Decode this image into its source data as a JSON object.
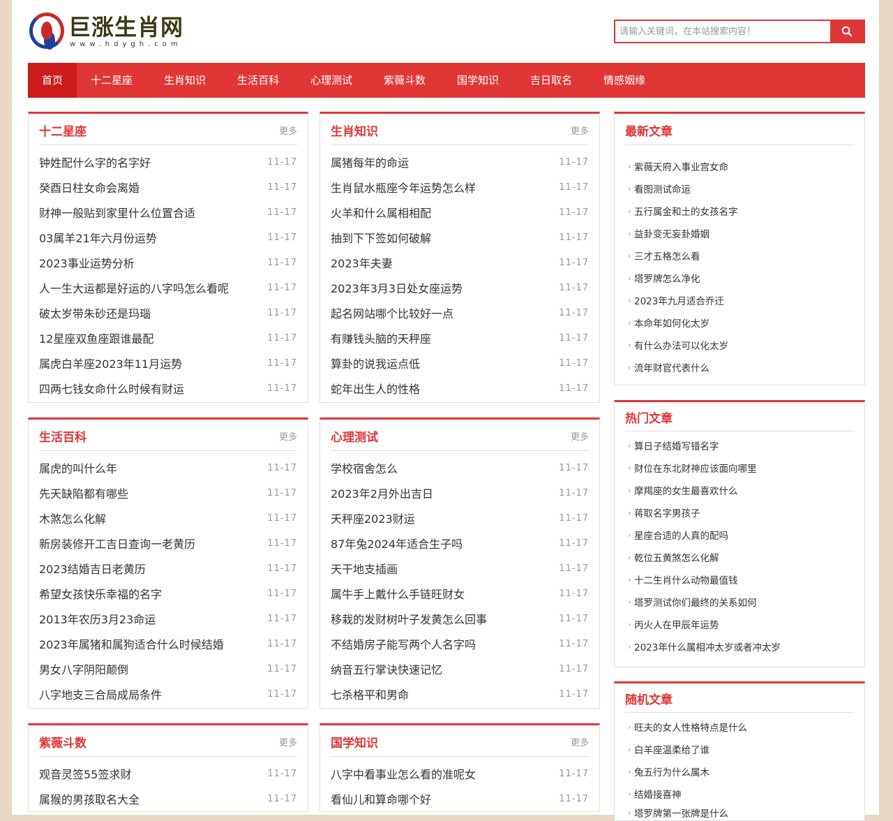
{
  "site": {
    "title": "巨涨生肖网",
    "url": "www.hdygh.com"
  },
  "search": {
    "placeholder": "请输入关键词，在本站搜索内容！"
  },
  "nav": [
    "首页",
    "十二星座",
    "生肖知识",
    "生活百科",
    "心理测试",
    "紫薇斗数",
    "国学知识",
    "吉日取名",
    "情感姻缘"
  ],
  "more_label": "更多",
  "modules": [
    {
      "title": "十二星座",
      "items": [
        [
          "钟姓配什么字的名字好",
          "11-17"
        ],
        [
          "癸酉日柱女命会离婚",
          "11-17"
        ],
        [
          "财神一般贴到家里什么位置合适",
          "11-17"
        ],
        [
          "03属羊21年六月份运势",
          "11-17"
        ],
        [
          "2023事业运势分析",
          "11-17"
        ],
        [
          "人一生大运都是好运的八字吗怎么看呢",
          "11-17"
        ],
        [
          "破太岁带朱砂还是玛瑙",
          "11-17"
        ],
        [
          "12星座双鱼座跟谁最配",
          "11-17"
        ],
        [
          "属虎白羊座2023年11月运势",
          "11-17"
        ],
        [
          "四两七钱女命什么时候有财运",
          "11-17"
        ]
      ]
    },
    {
      "title": "生肖知识",
      "items": [
        [
          "属猪每年的命运",
          "11-17"
        ],
        [
          "生肖鼠水瓶座今年运势怎么样",
          "11-17"
        ],
        [
          "火羊和什么属相相配",
          "11-17"
        ],
        [
          "抽到下下签如何破解",
          "11-17"
        ],
        [
          "2023年夫妻",
          "11-17"
        ],
        [
          "2023年3月3日处女座运势",
          "11-17"
        ],
        [
          "起名网站哪个比较好一点",
          "11-17"
        ],
        [
          "有赚钱头脑的天秤座",
          "11-17"
        ],
        [
          "算卦的说我运点低",
          "11-17"
        ],
        [
          "蛇年出生人的性格",
          "11-17"
        ]
      ]
    },
    {
      "title": "生活百科",
      "items": [
        [
          "属虎的叫什么年",
          "11-17"
        ],
        [
          "先天缺陷都有哪些",
          "11-17"
        ],
        [
          "木煞怎么化解",
          "11-17"
        ],
        [
          "新房装修开工吉日查询一老黄历",
          "11-17"
        ],
        [
          "2023结婚吉日老黄历",
          "11-17"
        ],
        [
          "希望女孩快乐幸福的名字",
          "11-17"
        ],
        [
          "2013年农历3月23命运",
          "11-17"
        ],
        [
          "2023年属猪和属狗适合什么时候结婚",
          "11-17"
        ],
        [
          "男女八字阴阳颠倒",
          "11-17"
        ],
        [
          "八字地支三合局成局条件",
          "11-17"
        ]
      ]
    },
    {
      "title": "心理测试",
      "items": [
        [
          "学校宿舍怎么",
          "11-17"
        ],
        [
          "2023年2月外出吉日",
          "11-17"
        ],
        [
          "天秤座2023财运",
          "11-17"
        ],
        [
          "87年兔2024年适合生子吗",
          "11-17"
        ],
        [
          "天干地支插画",
          "11-17"
        ],
        [
          "属牛手上戴什么手链旺财女",
          "11-17"
        ],
        [
          "移栽的发财树叶子发黄怎么回事",
          "11-17"
        ],
        [
          "不结婚房子能写两个人名字吗",
          "11-17"
        ],
        [
          "纳音五行掌诀快速记忆",
          "11-17"
        ],
        [
          "七杀格平和男命",
          "11-17"
        ]
      ]
    },
    {
      "title": "紫薇斗数",
      "items": [
        [
          "观音灵签55签求财",
          "11-17"
        ],
        [
          "属猴的男孩取名大全",
          "11-17"
        ]
      ]
    },
    {
      "title": "国学知识",
      "items": [
        [
          "八字中看事业怎么看的准呢女",
          "11-17"
        ],
        [
          "看仙儿和算命哪个好",
          "11-17"
        ]
      ]
    }
  ],
  "sidebar": [
    {
      "title": "最新文章",
      "items": [
        "紫薇天府入事业宫女命",
        "看图测试命运",
        "五行属金和土的女孩名字",
        "益卦变无妄卦婚姻",
        "三才五格怎么看",
        "塔罗牌怎么净化",
        "2023年九月适合乔迁",
        "本命年如何化太岁",
        "有什么办法可以化太岁",
        "流年财官代表什么"
      ]
    },
    {
      "title": "热门文章",
      "items": [
        "算日子结婚写错名字",
        "财位在东北财神应该面向哪里",
        "摩羯座的女生最喜欢什么",
        "蒋取名字男孩子",
        "星座合适的人真的配吗",
        "乾位五黄煞怎么化解",
        "十二生肖什么动物最值钱",
        "塔罗测试你们最终的关系如何",
        "丙火人在甲辰年运势",
        "2023年什么属相冲太岁或者冲太岁"
      ]
    },
    {
      "title": "随机文章",
      "items": [
        "旺夫的女人性格特点是什么",
        "白羊座温柔给了谁",
        "兔五行为什么属木",
        "结婚接喜神",
        "塔罗牌第一张牌是什么"
      ]
    }
  ]
}
